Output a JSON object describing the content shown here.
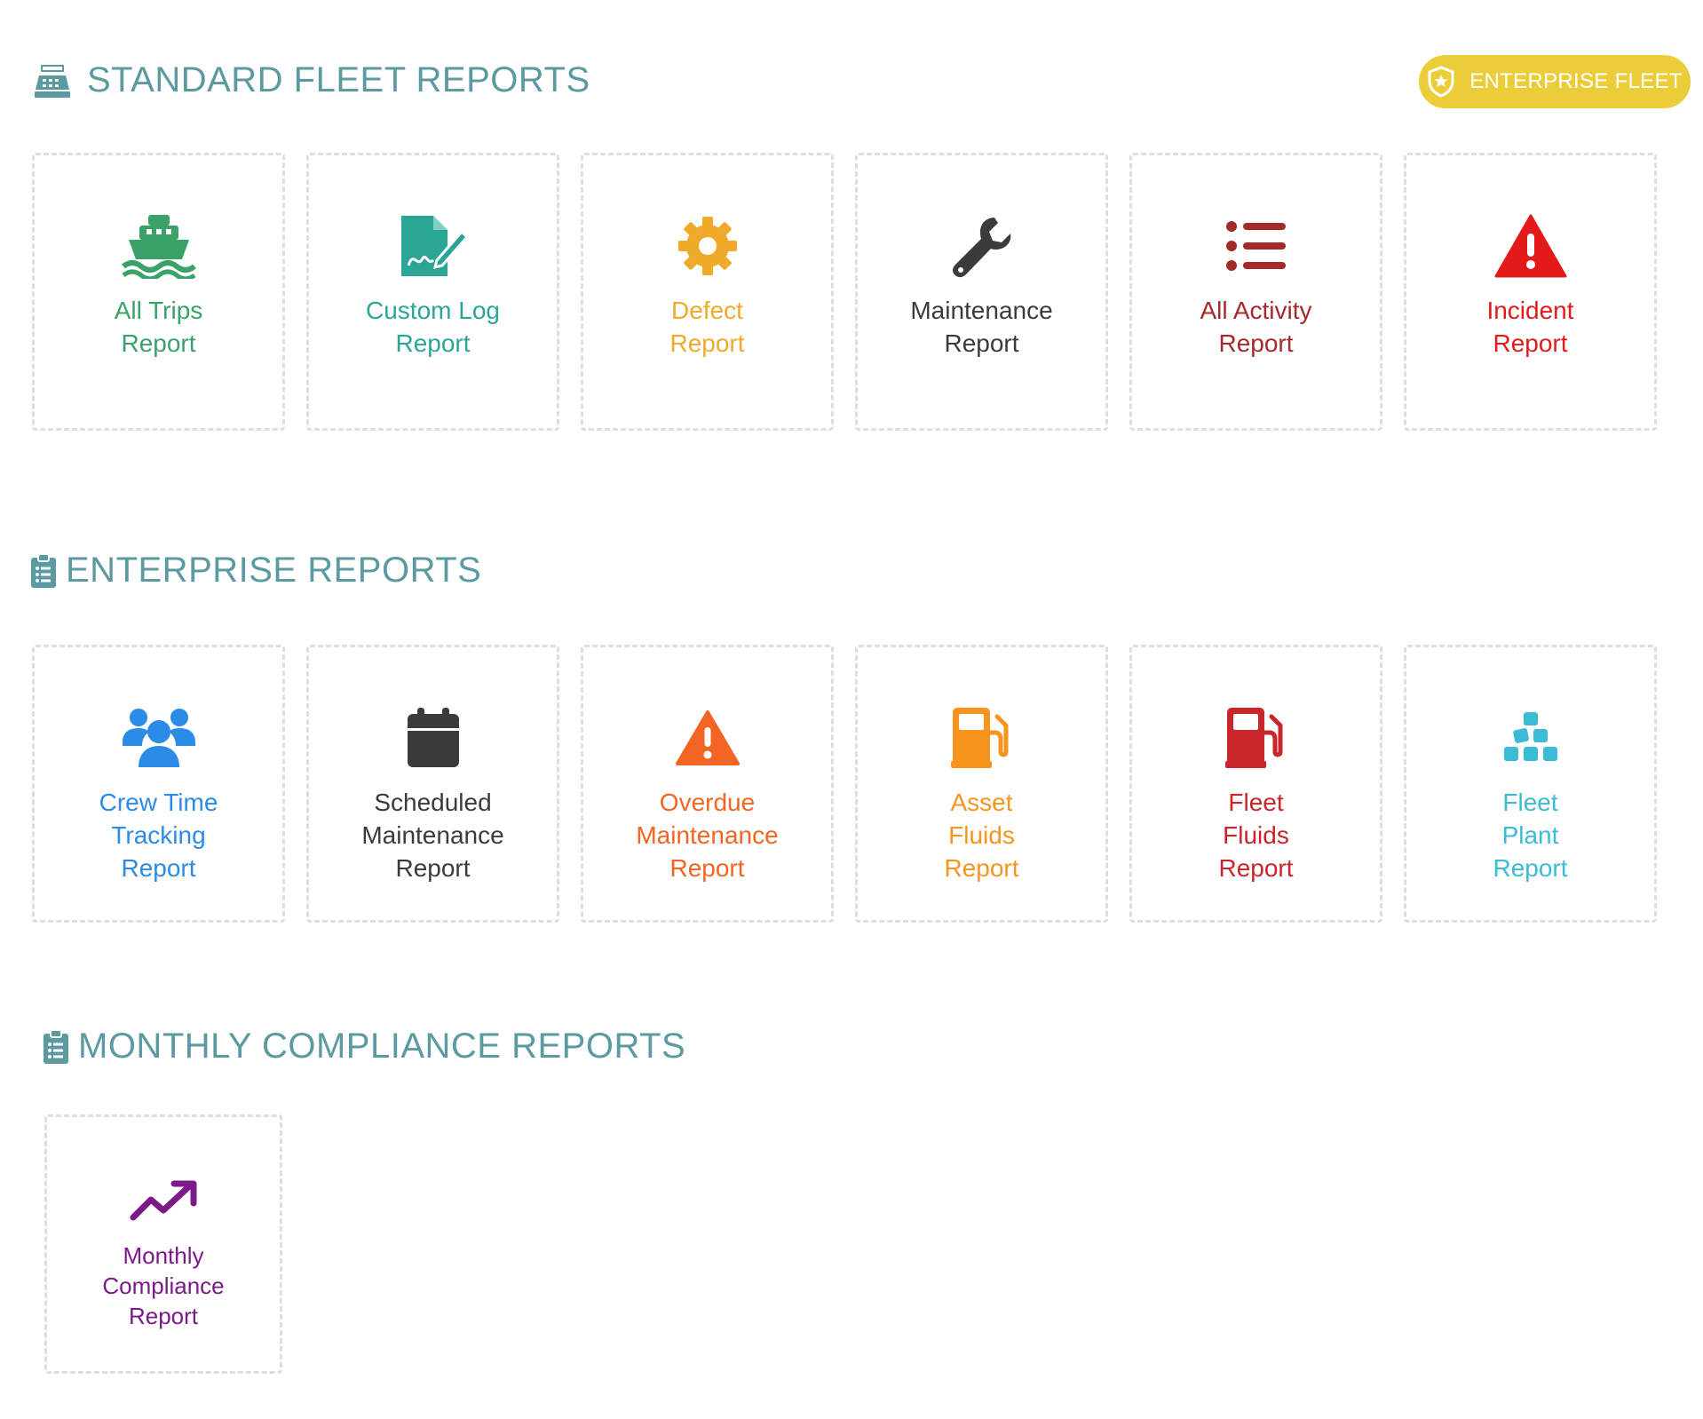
{
  "badge": {
    "label": "ENTERPRISE FLEET",
    "color": "#ebcd3a"
  },
  "sections": {
    "standard": {
      "title": "STANDARD FLEET REPORTS"
    },
    "enterprise": {
      "title": "ENTERPRISE REPORTS"
    },
    "monthly": {
      "title": "MONTHLY COMPLIANCE REPORTS"
    }
  },
  "standard_cards": [
    {
      "label": "All Trips\nReport",
      "color": "#3aa169",
      "icon": "ship-icon"
    },
    {
      "label": "Custom Log\nReport",
      "color": "#2ba596",
      "icon": "signature-icon"
    },
    {
      "label": "Defect\nReport",
      "color": "#f0a92a",
      "icon": "gear-icon"
    },
    {
      "label": "Maintenance\nReport",
      "color": "#3b3b3b",
      "icon": "wrench-icon"
    },
    {
      "label": "All Activity\nReport",
      "color": "#a52a2a",
      "icon": "list-icon"
    },
    {
      "label": "Incident\nReport",
      "color": "#e21a1a",
      "icon": "warning-icon"
    }
  ],
  "enterprise_cards": [
    {
      "label": "Crew Time\nTracking\nReport",
      "color": "#2b8be6",
      "icon": "users-icon"
    },
    {
      "label": "Scheduled\nMaintenance\nReport",
      "color": "#3b3b3b",
      "icon": "calendar-icon"
    },
    {
      "label": "Overdue\nMaintenance\nReport",
      "color": "#f26522",
      "icon": "warning-icon"
    },
    {
      "label": "Asset\nFluids\nReport",
      "color": "#f7941d",
      "icon": "fuel-pump-icon"
    },
    {
      "label": "Fleet\nFluids\nReport",
      "color": "#c8262b",
      "icon": "fuel-pump-icon"
    },
    {
      "label": "Fleet\nPlant\nReport",
      "color": "#3bbcd4",
      "icon": "cubes-icon"
    }
  ],
  "monthly_cards": [
    {
      "label": "Monthly\nCompliance\nReport",
      "color": "#7b1a88",
      "icon": "trend-up-icon"
    }
  ]
}
